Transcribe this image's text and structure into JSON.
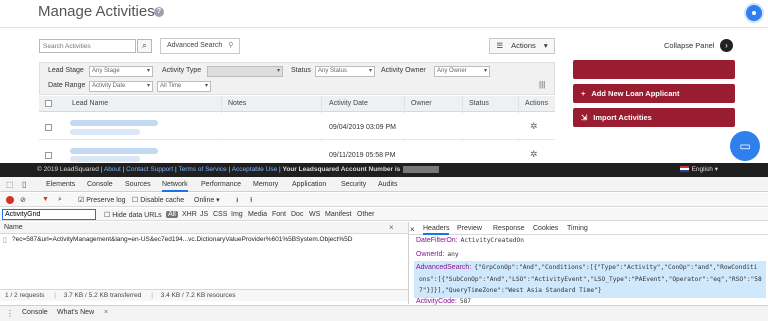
{
  "app": {
    "title": "Manage Activities",
    "help_icon": "?",
    "search_placeholder": "Search Activities",
    "advanced_search_label": "Advanced Search",
    "actions_label": "Actions",
    "collapse_label": "Collapse Panel",
    "filters": {
      "lead_stage_label": "Lead Stage",
      "lead_stage_value": "Any Stage",
      "activity_type_label": "Activity Type",
      "status_label": "Status",
      "status_value": "Any Status",
      "activity_owner_label": "Activity Owner",
      "activity_owner_value": "Any Owner",
      "date_range_label": "Date Range",
      "date_range_value": "Activity Date",
      "date_range_period": "All Time"
    },
    "table": {
      "columns": [
        "Lead Name",
        "Notes",
        "Activity Date",
        "Owner",
        "Status",
        "Actions"
      ],
      "rows": [
        {
          "activity_date": "09/04/2019 03:09 PM"
        },
        {
          "activity_date": "09/11/2019 05:58 PM"
        }
      ]
    },
    "right_panel": {
      "add_loan_label": "Add New Loan Applicant",
      "import_label": "Import Activities"
    }
  },
  "footer": {
    "copyright": "© 2019 LeadSquared",
    "about": "About",
    "contact": "Contact Support",
    "terms": "Terms of Service",
    "aup": "Acceptable Use",
    "account_prefix": "Your Leadsquared Account Number is",
    "language": "English"
  },
  "devtools": {
    "tabs": [
      "Elements",
      "Console",
      "Sources",
      "Network",
      "Performance",
      "Memory",
      "Application",
      "Security",
      "Audits"
    ],
    "preserve_log": "Preserve log",
    "disable_cache": "Disable cache",
    "throttle": "Online",
    "filter_value": "ActivityGrid",
    "hide_data_urls": "Hide data URLs",
    "types": [
      "All",
      "XHR",
      "JS",
      "CSS",
      "Img",
      "Media",
      "Font",
      "Doc",
      "WS",
      "Manifest",
      "Other"
    ],
    "name_header": "Name",
    "request_name": "?ec=587&url=ActivityManagement&lang=en-US&ec7ed194...vc.DictionaryValueProvider%601%5BSystem.Object%5D",
    "status_bar": {
      "requests": "1 / 2 requests",
      "transferred": "3.7 KB / 5.2 KB transferred",
      "resources": "3.4 KB / 7.2 KB resources"
    },
    "detail_tabs": [
      "Headers",
      "Preview",
      "Response",
      "Cookies",
      "Timing"
    ],
    "form_data": [
      {
        "key": "DateFilterOn:",
        "value": "ActivityCreatedOn"
      },
      {
        "key": "OwnerId:",
        "value": "any"
      },
      {
        "key": "AdvancedSearch:",
        "value": "{\"GrpConOp\":\"And\",\"Conditions\":[{\"Type\":\"Activity\",\"ConOp\":\"and\",\"RowConditi"
      },
      {
        "key": "",
        "value": "ons\":[{\"SubConOp\":\"And\",\"LSO\":\"ActivityEvent\",\"LSO_Type\":\"PAEvent\",\"Operator\":\"eq\",\"RSO\":\"58"
      },
      {
        "key": "",
        "value": "7\"}]}],\"QueryTimeZone\":\"West Asia Standard Time\"}"
      },
      {
        "key": "ActivityCode:",
        "value": "587"
      }
    ],
    "drawer_tabs": [
      "Console",
      "What's New"
    ]
  }
}
